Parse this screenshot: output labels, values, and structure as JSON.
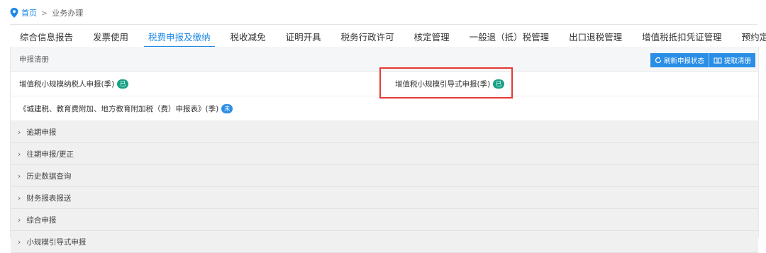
{
  "breadcrumb": {
    "home": "首页",
    "separator": ">",
    "current": "业务办理"
  },
  "tabs": [
    {
      "label": "综合信息报告",
      "active": false
    },
    {
      "label": "发票使用",
      "active": false
    },
    {
      "label": "税费申报及缴纳",
      "active": true
    },
    {
      "label": "税收减免",
      "active": false
    },
    {
      "label": "证明开具",
      "active": false
    },
    {
      "label": "税务行政许可",
      "active": false
    },
    {
      "label": "核定管理",
      "active": false
    },
    {
      "label": "一般退（抵）税管理",
      "active": false
    },
    {
      "label": "出口退税管理",
      "active": false
    },
    {
      "label": "增值税抵扣凭证管理",
      "active": false
    },
    {
      "label": "预约定价安排",
      "active": false
    }
  ],
  "panel": {
    "title": "申报清册",
    "refresh_button": "刷新申报状态",
    "clear_button": "提取清册"
  },
  "declarations": {
    "item1": {
      "label": "增值税小规模纳税人申报(季)",
      "badge": "已"
    },
    "item2": {
      "label": "增值税小规模引导式申报(季)",
      "badge": "已"
    },
    "item3": {
      "label": "《城建税、教育费附加、地方教育附加税（费）申报表》(季)",
      "badge": "未"
    }
  },
  "sections": [
    "逾期申报",
    "往期申报/更正",
    "历史数据查询",
    "财务报表报送",
    "综合申报",
    "小规模引导式申报"
  ],
  "colors": {
    "accent": "#1e88e5",
    "badge_done": "#16a085",
    "badge_pending": "#2b8ee6",
    "highlight": "#e53935"
  }
}
